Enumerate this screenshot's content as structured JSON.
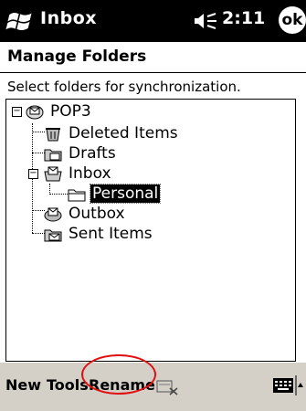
{
  "titlebar": {
    "app_title": "Inbox",
    "time": "2:11",
    "ok_label": "ok"
  },
  "page": {
    "title": "Manage Folders",
    "instructions": "Select folders for synchronization."
  },
  "tree": {
    "root": {
      "label": "POP3",
      "expander": "−"
    },
    "deleted_items": {
      "label": "Deleted Items"
    },
    "drafts": {
      "label": "Drafts"
    },
    "inbox": {
      "label": "Inbox",
      "expander": "−"
    },
    "personal": {
      "label": "Personal",
      "selected": true
    },
    "outbox": {
      "label": "Outbox"
    },
    "sent_items": {
      "label": "Sent Items"
    }
  },
  "menubar": {
    "new_label": "New",
    "tools_label": "Tools",
    "rename_label": "Rename"
  },
  "colors": {
    "titlebar_bg": "#000000",
    "menubar_bg": "#d4d0c8",
    "highlight_circle": "#e01010",
    "selection_bg": "#000000"
  }
}
